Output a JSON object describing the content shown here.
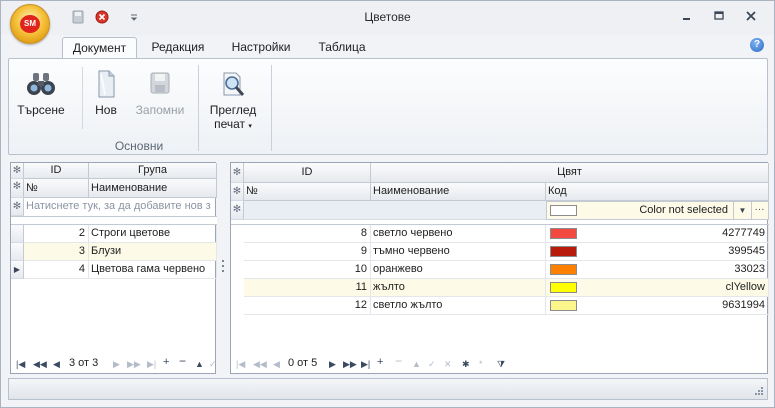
{
  "window": {
    "title": "Цветове",
    "logo_text": "SM"
  },
  "tabs": [
    {
      "label": "Документ",
      "active": true
    },
    {
      "label": "Редакция",
      "active": false
    },
    {
      "label": "Настройки",
      "active": false
    },
    {
      "label": "Таблица",
      "active": false
    }
  ],
  "help": {
    "label": "?"
  },
  "ribbon": {
    "search_label": "Търсене",
    "new_label": "Нов",
    "save_label": "Запомни",
    "preview_label_line1": "Преглед",
    "preview_label_line2": "печат",
    "group_label": "Основни"
  },
  "left_grid": {
    "headers": {
      "id": "ID",
      "group": "Група",
      "num": "№",
      "name": "Наименование"
    },
    "new_row_hint": "Натиснете тук, за да добавите нов з",
    "rows": [
      {
        "id": "2",
        "name": "Строги цветове"
      },
      {
        "id": "3",
        "name": "Блузи"
      },
      {
        "id": "4",
        "name": "Цветова гама червено"
      }
    ],
    "nav_position": "3 от 3"
  },
  "right_grid": {
    "headers": {
      "id": "ID",
      "color": "Цвят",
      "num": "№",
      "name": "Наименование",
      "code": "Код"
    },
    "new_row_color_text": "Color not selected",
    "rows": [
      {
        "id": "8",
        "name": "светло червено",
        "code": "4277749",
        "color": "#f24a40"
      },
      {
        "id": "9",
        "name": "тъмно червено",
        "code": "399545",
        "color": "#b81a0c"
      },
      {
        "id": "10",
        "name": "оранжево",
        "code": "33023",
        "color": "#ff8000"
      },
      {
        "id": "11",
        "name": "жълто",
        "code": "clYellow",
        "color": "#ffff00"
      },
      {
        "id": "12",
        "name": "светло жълто",
        "code": "9631994",
        "color": "#fbf58c"
      }
    ],
    "nav_position": "0 от 5"
  },
  "colors": {
    "selected_row": "#fdfbe8",
    "accent": "#3a6fc4"
  }
}
